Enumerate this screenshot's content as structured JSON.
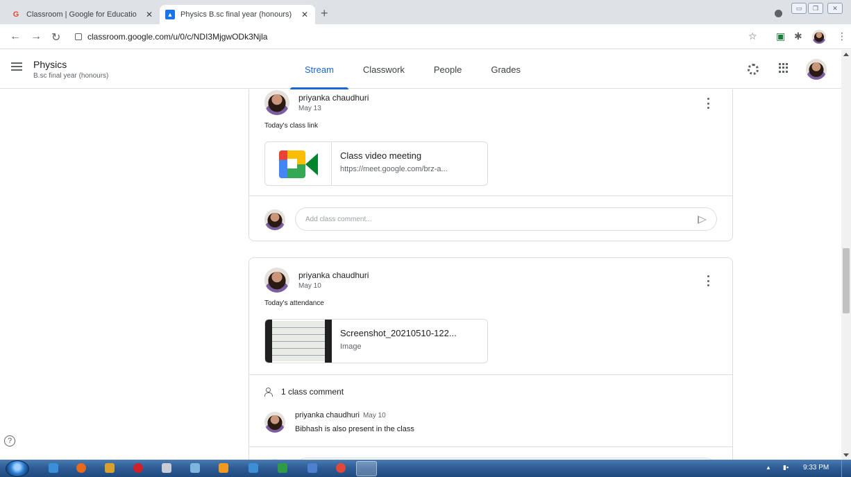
{
  "browser": {
    "tabs": [
      {
        "title": "Classroom | Google for Educatio",
        "favicon": "google-g-icon"
      },
      {
        "title": "Physics B.sc final year (honours)",
        "favicon": "classroom-icon"
      }
    ],
    "url": "classroom.google.com/u/0/c/NDI3MjgwODk3Njla"
  },
  "header": {
    "class_name": "Physics",
    "section": "B.sc final year (honours)",
    "tabs": [
      {
        "label": "Stream",
        "active": true
      },
      {
        "label": "Classwork",
        "active": false
      },
      {
        "label": "People",
        "active": false
      },
      {
        "label": "Grades",
        "active": false
      }
    ]
  },
  "posts": [
    {
      "author": "priyanka chaudhuri",
      "date": "May 13",
      "text": "Today's class link",
      "attachment": {
        "title": "Class video meeting",
        "subtitle": "https://meet.google.com/brz-a..."
      },
      "comment_placeholder": "Add class comment..."
    },
    {
      "author": "priyanka chaudhuri",
      "date": "May 10",
      "text": "Today's attendance",
      "attachment": {
        "title": "Screenshot_20210510-122...",
        "subtitle": "Image"
      },
      "comment_count": "1 class comment",
      "comments": [
        {
          "author": "priyanka chaudhuri",
          "date": "May 10",
          "text": "Bibhash  is also present in the class"
        }
      ]
    }
  ],
  "taskbar": {
    "clock": "9:33 PM"
  },
  "colors": {
    "accent": "#1967d2",
    "border": "#dadce0",
    "meet_green": "#00832d"
  }
}
